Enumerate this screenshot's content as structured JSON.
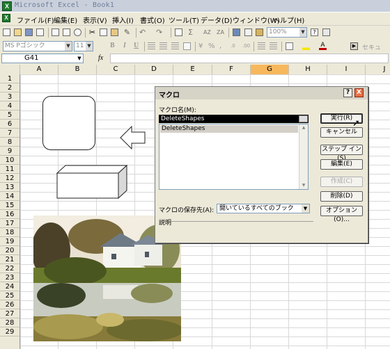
{
  "window": {
    "title": "Microsoft Excel - Book1",
    "app_icon": "excel-icon"
  },
  "menu": [
    "ファイル(F)",
    "編集(E)",
    "表示(V)",
    "挿入(I)",
    "書式(O)",
    "ツール(T)",
    "データ(D)",
    "ウィンドウ(W)",
    "ヘルプ(H)"
  ],
  "toolbar": {
    "zoom": "100%",
    "font_name": "MS Pゴシック",
    "font_size": "11",
    "overflow_text": "セキュ"
  },
  "formula_bar": {
    "name_box": "G41",
    "fx_label": "fx",
    "content": ""
  },
  "columns": [
    "A",
    "B",
    "C",
    "D",
    "E",
    "F",
    "G",
    "H",
    "I",
    "J"
  ],
  "rows": [
    "1",
    "2",
    "3",
    "4",
    "5",
    "6",
    "7",
    "8",
    "9",
    "10",
    "11",
    "12",
    "13",
    "14",
    "15",
    "16",
    "17",
    "18",
    "19",
    "20",
    "21",
    "22",
    "23",
    "24",
    "25",
    "26",
    "27",
    "28",
    "29"
  ],
  "dialog": {
    "title": "マクロ",
    "macro_name_label": "マクロ名(M):",
    "macro_name_value": "DeleteShapes",
    "macro_list": [
      "DeleteShapes"
    ],
    "location_label": "マクロの保存先(A):",
    "location_value": "開いているすべてのブック",
    "description_label": "説明",
    "buttons": {
      "run": "実行(R)",
      "cancel": "キャンセル",
      "step_into": "ステップ イン(S)",
      "edit": "編集(E)",
      "create": "作成(C)",
      "delete": "削除(D)",
      "options": "オプション(O)..."
    },
    "help_label": "?",
    "close_label": "X"
  },
  "colors": {
    "selected_header": "#f7b75c",
    "dialog_bg": "#ece9d8",
    "toolbar_bg": "#ece9d8"
  }
}
